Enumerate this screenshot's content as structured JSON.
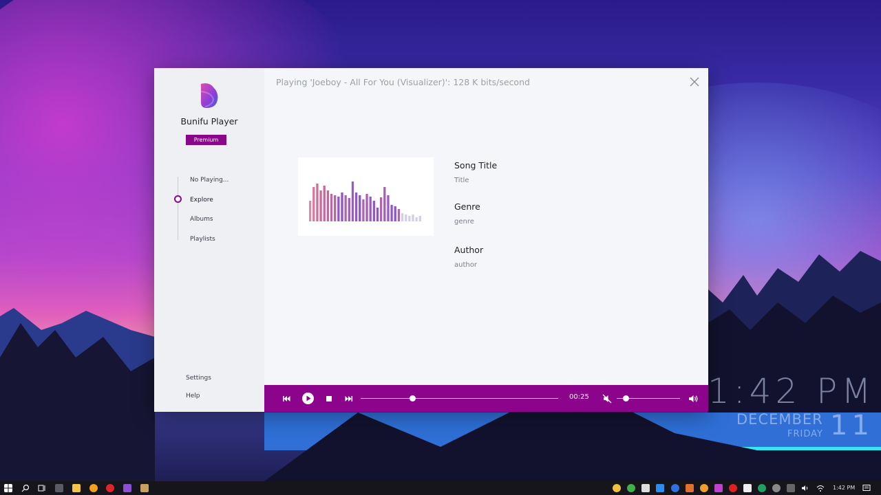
{
  "app": {
    "name": "Bunifu Player",
    "badge": "Premium",
    "status_text": "Playing 'Joeboy - All For You (Visualizer)': 128 K bits/second"
  },
  "sidebar": {
    "items": [
      {
        "label": "No Playing..."
      },
      {
        "label": "Explore"
      },
      {
        "label": "Albums"
      },
      {
        "label": "Playlists"
      }
    ],
    "active_index": 1,
    "bottom": [
      {
        "label": "Settings"
      },
      {
        "label": "Help"
      }
    ]
  },
  "song": {
    "title_label": "Song Title",
    "title_value": "Title",
    "genre_label": "Genre",
    "genre_value": "genre",
    "author_label": "Author",
    "author_value": "author"
  },
  "player": {
    "elapsed": "00:25",
    "progress": 0.26,
    "volume": 0.14,
    "muted": true
  },
  "desktop_clock": {
    "time": "1:42 PM",
    "month": "DECEMBER",
    "day": "11",
    "weekday": "FRIDAY"
  },
  "taskbar": {
    "time": "1:42 PM"
  },
  "colors": {
    "accent": "#8c048c",
    "sidebar_bg": "#eef0f4",
    "content_bg": "#f5f6f9"
  }
}
